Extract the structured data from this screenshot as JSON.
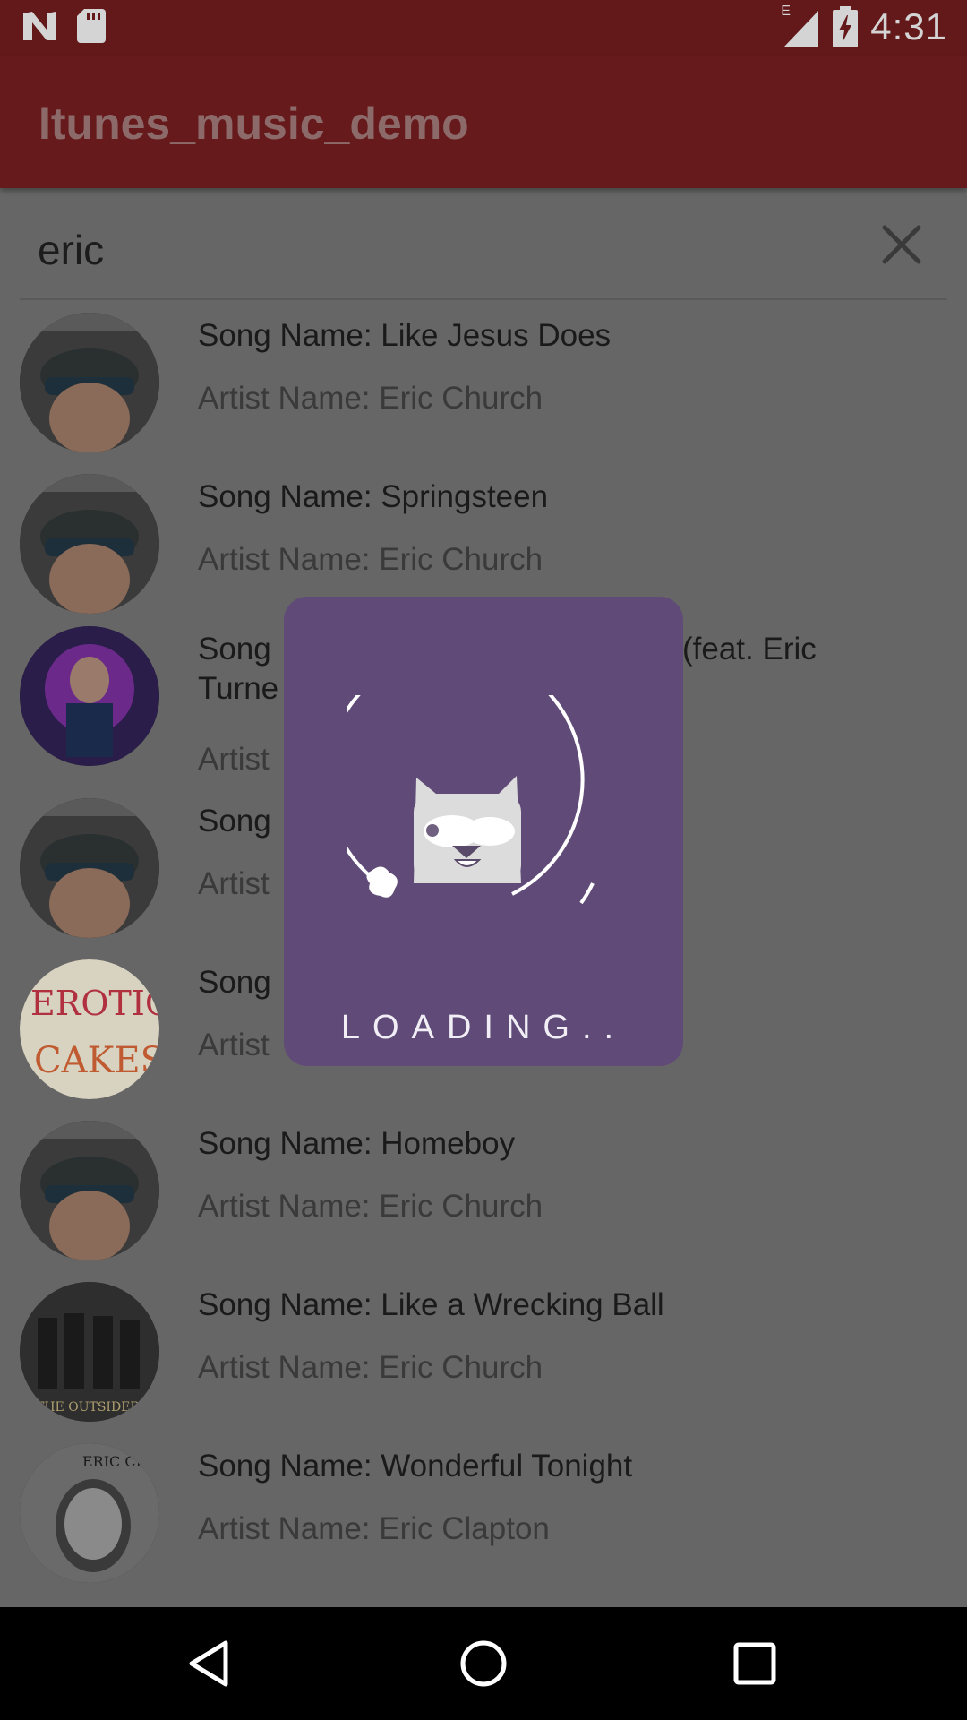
{
  "status_bar": {
    "time": "4:31",
    "network_type": "E",
    "icons": [
      "n-icon",
      "sd-card-icon",
      "signal-icon",
      "battery-charging-icon"
    ]
  },
  "app_bar": {
    "title": "Itunes_music_demo"
  },
  "search": {
    "value": "eric"
  },
  "songs": [
    {
      "song": "Song Name: Like Jesus Does",
      "artist": "Artist Name: Eric Church"
    },
    {
      "song": "Song Name: Springsteen",
      "artist": "Artist Name: Eric Church"
    },
    {
      "song_left": "Song",
      "song_right": "(feat. Eric",
      "song_line2": "Turne",
      "artist": "Artist"
    },
    {
      "song": "Song",
      "artist": "Artist"
    },
    {
      "song": "Song",
      "artist": "Artist"
    },
    {
      "song": "Song Name: Homeboy",
      "artist": "Artist Name: Eric Church"
    },
    {
      "song": "Song Name: Like a Wrecking Ball",
      "artist": "Artist Name: Eric Church"
    },
    {
      "song": "Song Name: Wonderful Tonight",
      "artist": "Artist Name: Eric Clapton"
    }
  ],
  "loading": {
    "text": "LOADING.."
  },
  "colors": {
    "status_bar": "#63191a",
    "app_bar": "#661a1b",
    "overlay_bg": "#666666",
    "dialog": "#604b78"
  }
}
